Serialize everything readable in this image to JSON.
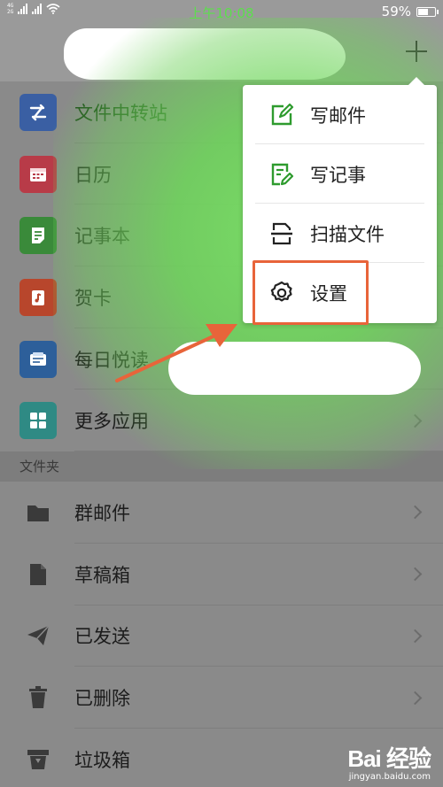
{
  "status_bar": {
    "network_top": "4G",
    "network_bottom": "2G",
    "time": "上午10:08",
    "battery": "59%"
  },
  "colors": {
    "accent_green": "#2e9b2e",
    "highlight_orange": "#e8643a"
  },
  "app_list": [
    {
      "label": "文件中转站",
      "icon": "file-transfer-icon",
      "color": "#3a5fa3",
      "accent": true
    },
    {
      "label": "日历",
      "icon": "calendar-icon",
      "color": "#b83b48"
    },
    {
      "label": "记事本",
      "icon": "notepad-icon",
      "color": "#3a8a3a"
    },
    {
      "label": "贺卡",
      "icon": "greeting-card-icon",
      "color": "#b8462c"
    },
    {
      "label": "每日悦读",
      "icon": "daily-reading-icon",
      "color": "#2d5f9a"
    },
    {
      "label": "更多应用",
      "icon": "more-apps-icon",
      "color": "#2f8a84"
    }
  ],
  "folders": {
    "section_title": "文件夹",
    "items": [
      {
        "label": "群邮件",
        "icon": "group-mail-icon"
      },
      {
        "label": "草稿箱",
        "icon": "drafts-icon"
      },
      {
        "label": "已发送",
        "icon": "sent-icon"
      },
      {
        "label": "已删除",
        "icon": "trash-icon"
      },
      {
        "label": "垃圾箱",
        "icon": "spam-icon"
      }
    ]
  },
  "popup_menu": [
    {
      "label": "写邮件",
      "icon": "compose-mail-icon"
    },
    {
      "label": "写记事",
      "icon": "write-note-icon"
    },
    {
      "label": "扫描文件",
      "icon": "scan-file-icon"
    },
    {
      "label": "设置",
      "icon": "settings-gear-icon"
    }
  ],
  "watermark": {
    "logo": "Bai 经验",
    "url": "jingyan.baidu.com"
  }
}
